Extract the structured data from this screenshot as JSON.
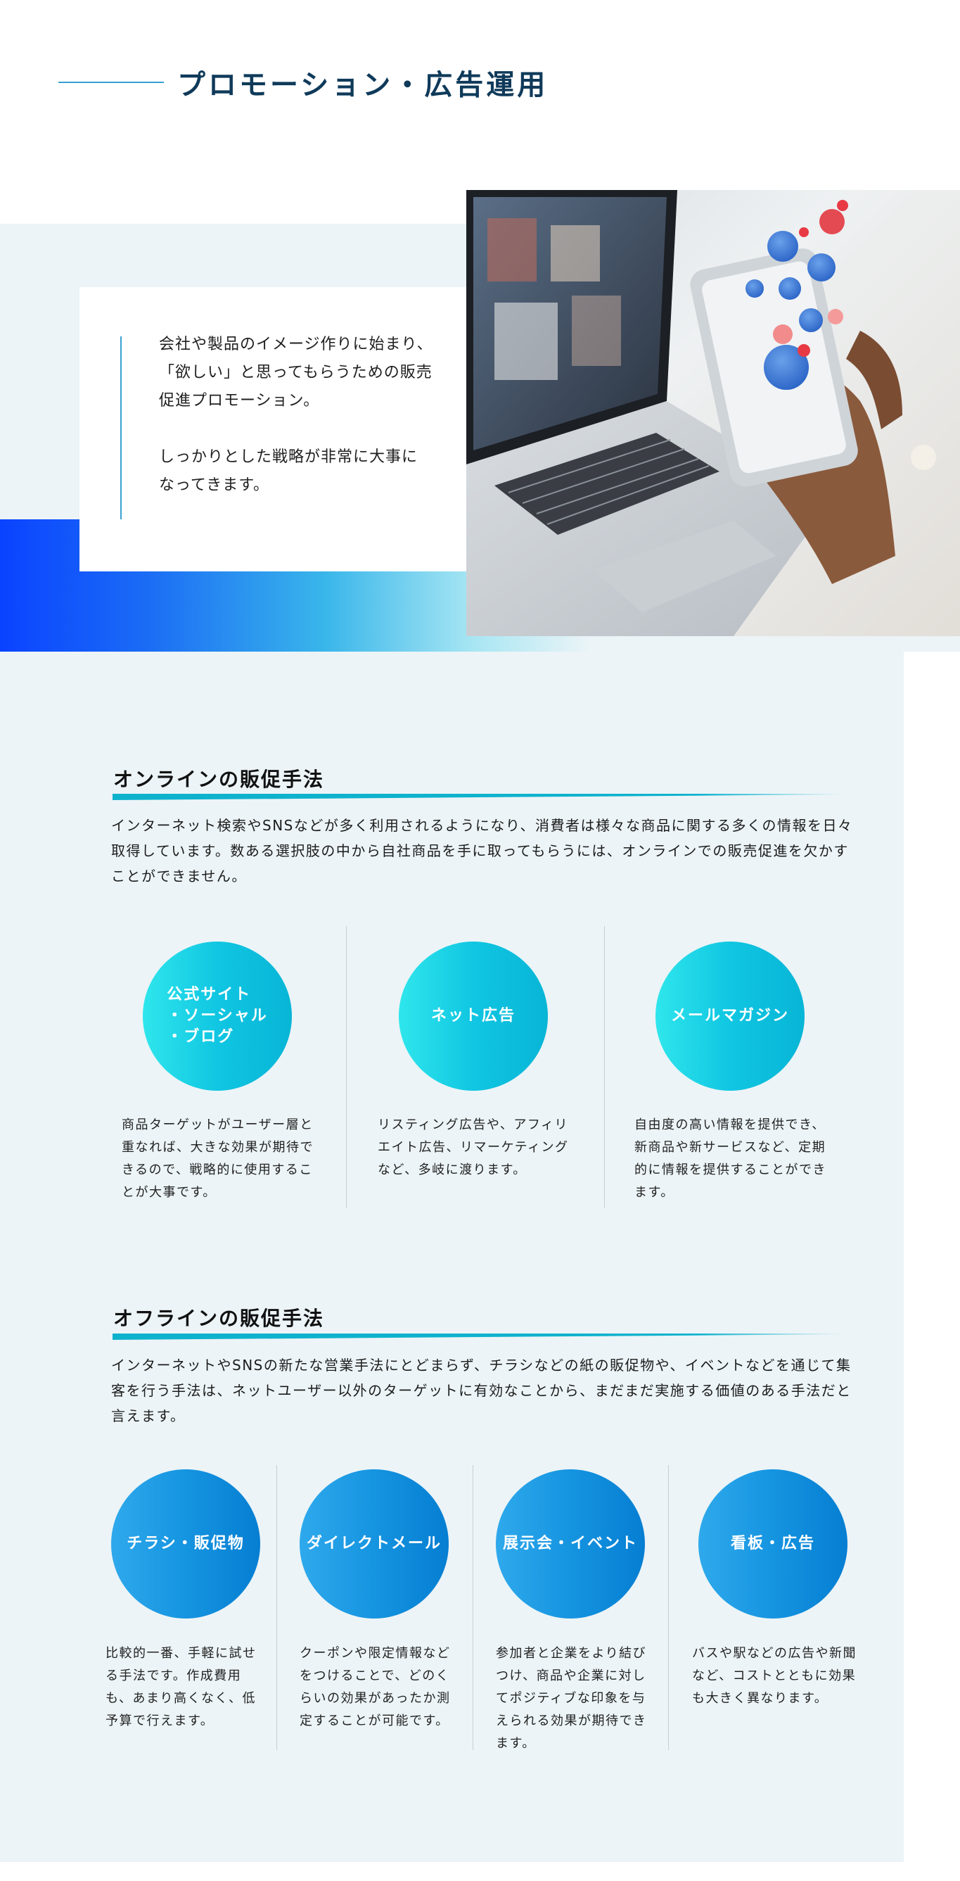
{
  "header": {
    "title": "プロモーション・広告運用"
  },
  "hero": {
    "paragraph1": "会社や製品のイメージ作りに始まり、「欲しい」と思ってもらうための販売促進プロモーション。",
    "paragraph2": "しっかりとした戦略が非常に大事になってきます。"
  },
  "online": {
    "title": "オンラインの販促手法",
    "description": "インターネット検索やSNSなどが多く利用されるようになり、消費者は様々な商品に関する多くの情報を日々取得しています。数ある選択肢の中から自社商品を手に取ってもらうには、オンラインでの販売促進を欠かすことができません。",
    "items": [
      {
        "line1": "公式サイト",
        "line2": "・ソーシャル",
        "line3": "・ブログ",
        "description": "商品ターゲットがユーザー層と重なれば、大きな効果が期待できるので、戦略的に使用することが大事です。"
      },
      {
        "label": "ネット広告",
        "description": "リスティング広告や、アフィリエイト広告、リマーケティングなど、多岐に渡ります。"
      },
      {
        "label": "メールマガジン",
        "description": "自由度の高い情報を提供でき、新商品や新サービスなど、定期的に情報を提供することができます。"
      }
    ]
  },
  "offline": {
    "title": "オフラインの販促手法",
    "description": "インターネットやSNSの新たな営業手法にとどまらず、チラシなどの紙の販促物や、イベントなどを通じて集客を行う手法は、ネットユーザー以外のターゲットに有効なことから、まだまだ実施する価値のある手法だと言えます。",
    "items": [
      {
        "label": "チラシ・販促物",
        "description": "比較的一番、手軽に試せる手法です。作成費用も、あまり高くなく、低予算で行えます。"
      },
      {
        "label": "ダイレクトメール",
        "description": "クーポンや限定情報などをつけることで、どのくらいの効果があったか測定することが可能です。"
      },
      {
        "label": "展示会・イベント",
        "description": "参加者と企業をより結びつけ、商品や企業に対してポジティブな印象を与えられる効果が期待できます。"
      },
      {
        "label": "看板・広告",
        "description": "バスや駅などの広告や新聞など、コストとともに効果も大きく異なります。"
      }
    ]
  },
  "colors": {
    "title": "#0f3a5a",
    "accent": "#0fb2cd",
    "online_circle": "#10c6e2",
    "offline_circle": "#1594e0",
    "hero_gradient_start": "#0a43ff"
  },
  "icons": {
    "hero_photo": "laptop-phone-social-likes-photo"
  }
}
